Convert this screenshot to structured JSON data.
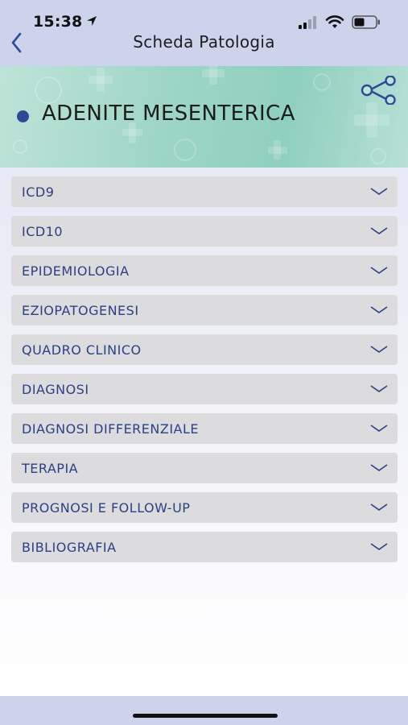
{
  "status_bar": {
    "time": "15:38"
  },
  "nav": {
    "title": "Scheda Patologia",
    "back_icon": "chevron-left-icon"
  },
  "banner": {
    "title": "ADENITE MESENTERICA",
    "share_icon": "share-icon"
  },
  "sections": [
    {
      "label": "ICD9"
    },
    {
      "label": "ICD10"
    },
    {
      "label": "EPIDEMIOLOGIA"
    },
    {
      "label": "EZIOPATOGENESI"
    },
    {
      "label": "QUADRO CLINICO"
    },
    {
      "label": "DIAGNOSI"
    },
    {
      "label": "DIAGNOSI DIFFERENZIALE"
    },
    {
      "label": "TERAPIA"
    },
    {
      "label": "PROGNOSI E FOLLOW-UP"
    },
    {
      "label": "BIBLIOGRAFIA"
    }
  ],
  "colors": {
    "accent": "#2c3f86",
    "bar_background": "#cdd3ea",
    "section_background": "#dcdcde",
    "banner_teal": "#9ed6c6"
  }
}
